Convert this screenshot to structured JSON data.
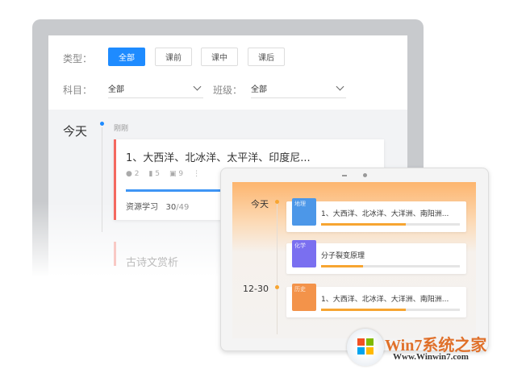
{
  "filters": {
    "type_label": "类型：",
    "type_options": [
      "全部",
      "课前",
      "课中",
      "课后"
    ],
    "subject_label": "科目：",
    "subject_value": "全部",
    "class_label": "班级：",
    "class_value": "全部"
  },
  "timeline": {
    "date": "今天",
    "time": "刚刚",
    "card": {
      "title": "1、大西洋、北冰洋、太平洋、印度尼...",
      "stats": [
        "2",
        "5",
        "9"
      ],
      "progress_label": "资源学习",
      "progress_done": "30",
      "progress_total": "/49",
      "progress": 0.61
    },
    "next_title": "古诗文赏析"
  },
  "tablet": {
    "groups": [
      {
        "date": "今天",
        "items": [
          {
            "subject": "地理",
            "title": "1、大西洋、北冰洋、大洋洲、南阳洲...",
            "progress": 0.61,
            "color": "#4c97e8"
          },
          {
            "subject": "化学",
            "title": "分子裂变原理",
            "progress": 0.3,
            "color": "#7a6ff0"
          }
        ]
      },
      {
        "date": "12-30",
        "items": [
          {
            "subject": "历史",
            "title": "1、大西洋、北冰洋、大洋洲、南阳洲...",
            "progress": 0.61,
            "color": "#f3934a"
          }
        ]
      }
    ]
  },
  "watermark": {
    "brand": "Win7系统之家",
    "url": "Www.Winwin7.com"
  }
}
